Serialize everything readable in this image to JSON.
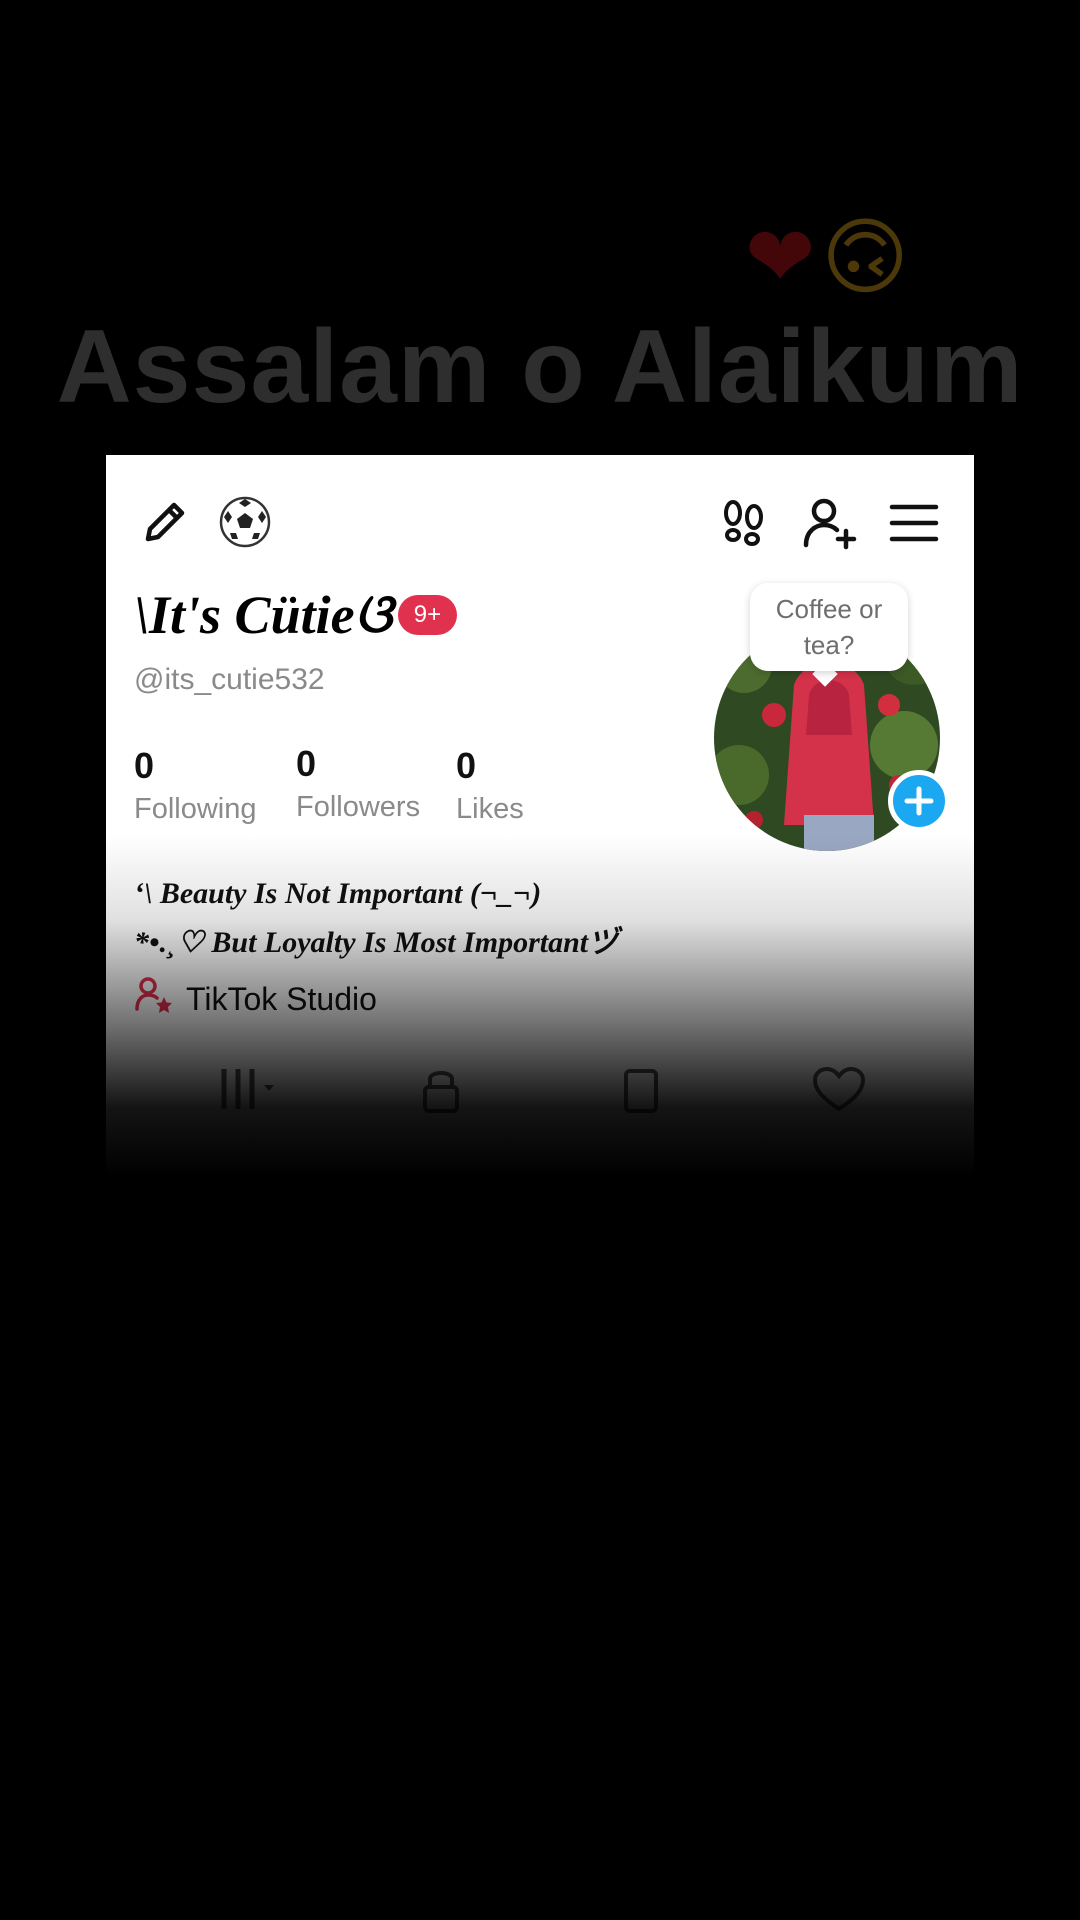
{
  "overlay": {
    "headline": "Assalam o Alaikum",
    "emojis": [
      "❤",
      "🙃"
    ]
  },
  "topbar": {
    "icons": [
      "pencil-icon",
      "soccer-ball-icon",
      "footprints-icon",
      "add-user-icon",
      "menu-icon"
    ]
  },
  "profile": {
    "display_name": "It's Cütie",
    "name_prefix_glyph": "\\",
    "name_suffix_glyph": "ଓ",
    "notification_badge": "9+",
    "handle": "@its_cutie532",
    "bubble_text": "Coffee or tea?",
    "bubble_line1": "Coffee or",
    "bubble_line2": "tea?",
    "colors": {
      "badge": "#e0314f",
      "plus_button": "#1ba8f0",
      "studio_icon": "#e0314f"
    }
  },
  "stats": [
    {
      "value": "0",
      "label": "Following"
    },
    {
      "value": "0",
      "label": "Followers"
    },
    {
      "value": "0",
      "label": "Likes"
    }
  ],
  "bio": {
    "line1": "‘\\ Beauty Is Not Important (¬_¬)",
    "line2": "*•.¸♡ But Loyalty Is Most Importantヅ"
  },
  "studio": {
    "label": "TikTok Studio",
    "icon": "user-star-icon"
  },
  "tabs": [
    "videos-tab-icon",
    "lock-tab-icon",
    "repost-tab-icon",
    "liked-tab-icon"
  ]
}
